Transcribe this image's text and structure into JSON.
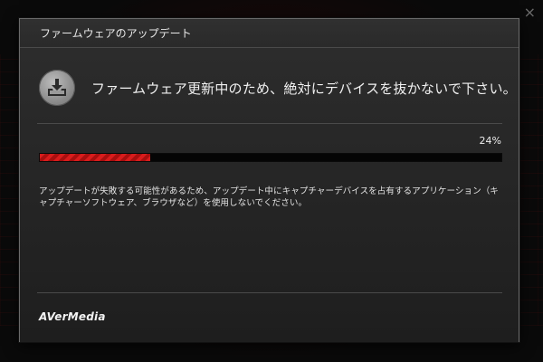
{
  "dialog": {
    "title": "ファームウェアのアップデート",
    "heading": "ファームウェア更新中のため、絶対にデバイスを抜かないで下さい。",
    "icon": "download-tray-icon",
    "progress": {
      "percent_label": "24%",
      "value": 0.24,
      "fill_color": "#d91c1c"
    },
    "notice": "アップデートが失敗する可能性があるため、アップデート中にキャプチャーデバイスを占有するアプリケーション（キャプチャーソフトウェア、ブラウザなど）を使用しないでください。",
    "brand": "AVerMedia"
  },
  "background": {
    "close_glyph": "×"
  }
}
